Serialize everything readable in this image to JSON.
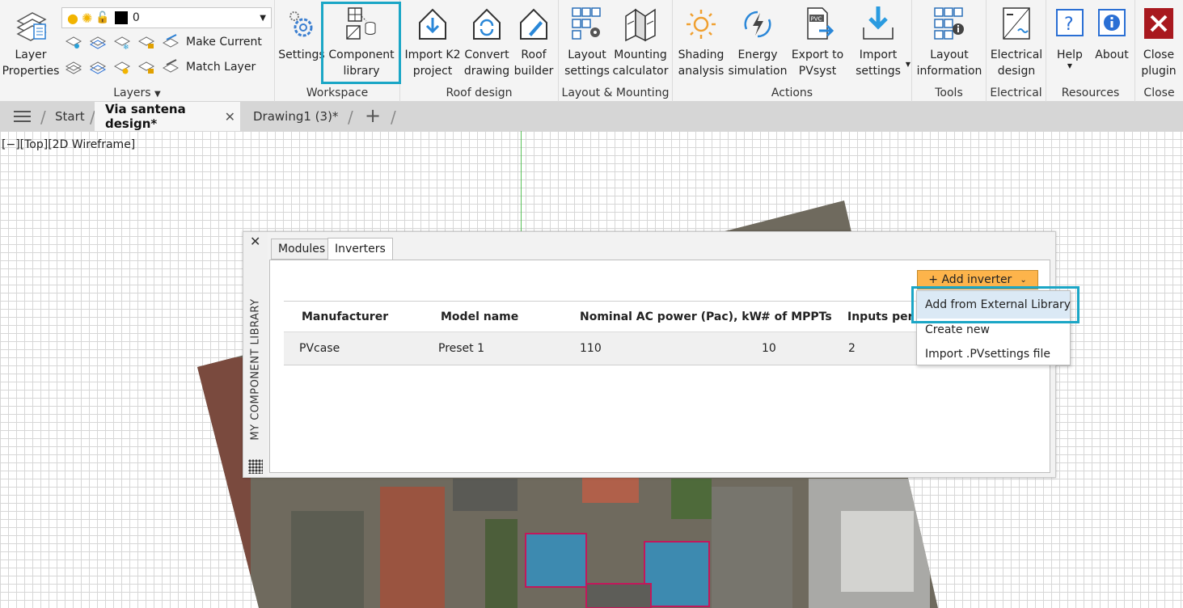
{
  "ribbon": {
    "groups": {
      "layers": "Layers",
      "workspace": "Workspace",
      "roof_design": "Roof design",
      "layout_mounting": "Layout & Mounting",
      "actions": "Actions",
      "tools": "Tools",
      "electrical": "Electrical",
      "resources": "Resources",
      "close": "Close"
    },
    "buttons": {
      "layer_properties": "Layer\nProperties",
      "make_current": "Make Current",
      "match_layer": "Match Layer",
      "layer_value": "0",
      "settings": "Settings",
      "component_library": "Component\nlibrary",
      "import_k2": "Import K2\nproject",
      "convert_drawing": "Convert\ndrawing",
      "roof_builder": "Roof\nbuilder",
      "layout_settings": "Layout\nsettings",
      "mounting_calculator": "Mounting\ncalculator",
      "shading_analysis": "Shading\nanalysis",
      "energy_simulation": "Energy\nsimulation",
      "export_pvsyst": "Export to\nPVsyst",
      "import_settings": "Import\nsettings",
      "layout_information": "Layout\ninformation",
      "electrical_design": "Electrical\ndesign",
      "help": "Help",
      "about": "About",
      "close_plugin": "Close\nplugin",
      "pvc_badge": "PVC"
    },
    "accent": "#1ba6c6"
  },
  "tabs": {
    "start": "Start",
    "active": "Via santena design*",
    "drawing": "Drawing1 (3)*"
  },
  "viewport": {
    "label": "[−][Top][2D Wireframe]"
  },
  "panel": {
    "side_title": "MY COMPONENT LIBRARY",
    "tabs": [
      "Modules",
      "Inverters"
    ],
    "add_button": "+ Add inverter",
    "columns": [
      "Manufacturer",
      "Model name",
      "Nominal AC power (Pac), kW",
      "# of MPPTs",
      "Inputs per M"
    ],
    "rows": [
      [
        "PVcase",
        "Preset 1",
        "110",
        "10",
        "2"
      ]
    ]
  },
  "dropdown": {
    "items": [
      "Add from External Library",
      "Create new",
      "Import .PVsettings file"
    ]
  }
}
